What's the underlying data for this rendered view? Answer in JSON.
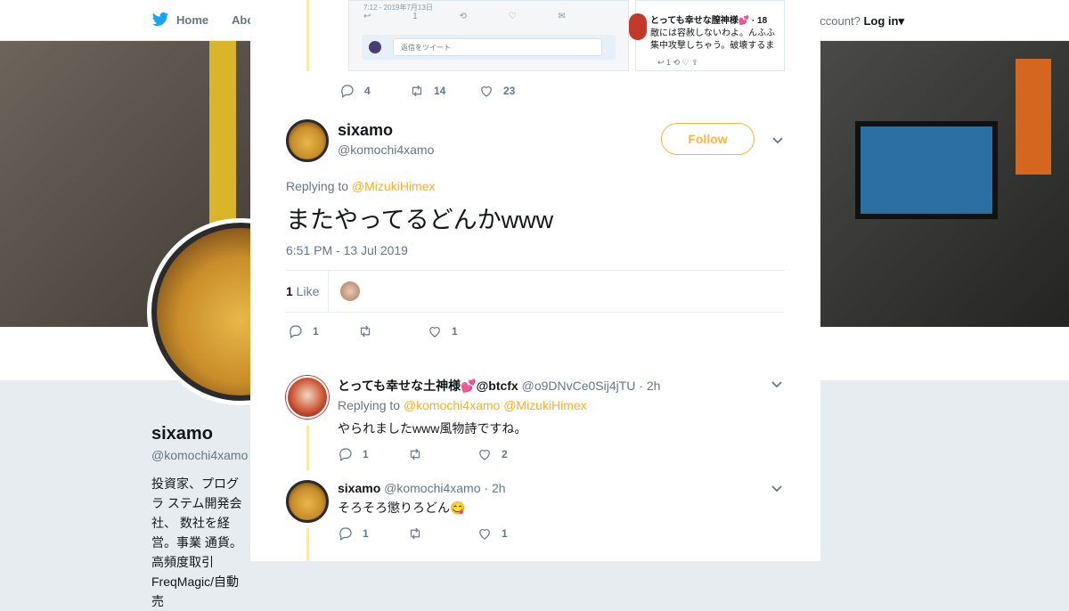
{
  "nav": {
    "home": "Home",
    "about": "Abo",
    "account_prompt": "ccount?",
    "login": "Log in"
  },
  "profile": {
    "name": "sixamo",
    "handle": "@komochi4xamo",
    "bio": "投資家、プログラ ステム開発会社、 数社を経営。事業 通貨。高頻度取引 FreqMagic/自動売"
  },
  "media": {
    "shot1_meta": "7:12 - 2019年7月13日",
    "shot1_icons": "↩ 1   ⟲   ♡   ✉",
    "shot1_reply_placeholder": "返信をツイート",
    "shot2_title": "とっても幸せな膣神様💕 · 18",
    "shot2_line1": "敵には容赦しないわよ。んふふ",
    "shot2_line2": "集中攻撃しちゃう。破壊するま",
    "shot2_icons": "↩ 1   ⟲   ♡   ⇪"
  },
  "top_actions": {
    "replies": "4",
    "retweets": "14",
    "likes": "23"
  },
  "tweet": {
    "name": "sixamo",
    "handle": "@komochi4xamo",
    "follow_label": "Follow",
    "replying_prefix": "Replying to ",
    "replying_mention": "@MizukiHimex",
    "text": "またやってるどんかwww",
    "time": "6:51 PM - 13 Jul 2019",
    "like_count": "1",
    "like_label": " Like",
    "actions": {
      "replies": "1",
      "retweets": "",
      "likes": "1"
    }
  },
  "replies": [
    {
      "name": "とっても幸せな土神様💕@btcfx",
      "handle": "@o9DNvCe0Sij4jTU",
      "time": "· 2h",
      "replying_prefix": "Replying to ",
      "replying_mentions": "@komochi4xamo @MizukiHimex",
      "text": "やられましたwww風物詩ですね。",
      "actions": {
        "replies": "1",
        "retweets": "",
        "likes": "2"
      }
    },
    {
      "name": "sixamo",
      "handle": "@komochi4xamo",
      "time": "· 2h",
      "text": "そろそろ懲りろどん😋",
      "actions": {
        "replies": "1",
        "retweets": "",
        "likes": "1"
      }
    }
  ],
  "colors": {
    "accent": "#ffad1f",
    "thread_line": "#ffe8a6",
    "text": "#14171a",
    "muted": "#657786"
  },
  "icons": {
    "close": "close-icon",
    "reply": "reply-icon",
    "retweet": "retweet-icon",
    "like": "heart-icon",
    "caret": "chevron-down-icon",
    "brand": "twitter-bird-icon"
  }
}
